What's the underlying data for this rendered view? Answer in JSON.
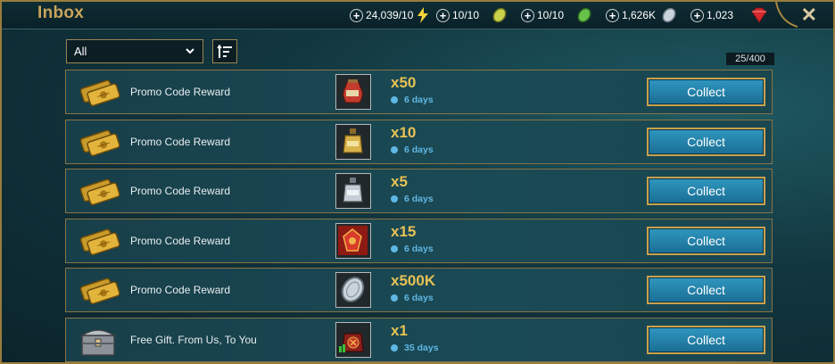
{
  "header": {
    "title": "Inbox",
    "resources": [
      {
        "value": "24,039/10",
        "icon": "energy-icon",
        "color": "#f3d33a"
      },
      {
        "value": "10/10",
        "icon": "arena-token-icon",
        "color": "#c9d24a"
      },
      {
        "value": "10/10",
        "icon": "tag-arena-token-icon",
        "color": "#66c24a"
      },
      {
        "value": "1,626K",
        "icon": "silver-icon",
        "color": "#c8d3db"
      },
      {
        "value": "1,023",
        "icon": "gem-icon",
        "color": "#d4282c"
      }
    ],
    "close": "✕"
  },
  "filter": {
    "selected": "All",
    "count": "25/400"
  },
  "messages": [
    {
      "label": "Promo Code Reward",
      "qty": "x50",
      "days": "6 days",
      "icon": "gold-tickets-icon",
      "item": "potion-jug-icon",
      "button": "Collect"
    },
    {
      "label": "Promo Code Reward",
      "qty": "x10",
      "days": "6 days",
      "icon": "gold-tickets-icon",
      "item": "gold-flask-icon",
      "button": "Collect"
    },
    {
      "label": "Promo Code Reward",
      "qty": "x5",
      "days": "6 days",
      "icon": "gold-tickets-icon",
      "item": "silver-flask-icon",
      "button": "Collect"
    },
    {
      "label": "Promo Code Reward",
      "qty": "x15",
      "days": "6 days",
      "icon": "gold-tickets-icon",
      "item": "xp-brew-icon",
      "button": "Collect"
    },
    {
      "label": "Promo Code Reward",
      "qty": "x500K",
      "days": "6 days",
      "icon": "gold-tickets-icon",
      "item": "silver-coin-icon",
      "button": "Collect"
    },
    {
      "label": "Free Gift. From Us, To You",
      "qty": "x1",
      "days": "35 days",
      "icon": "chest-icon",
      "item": "gift-bag-icon",
      "button": "Collect"
    }
  ]
}
